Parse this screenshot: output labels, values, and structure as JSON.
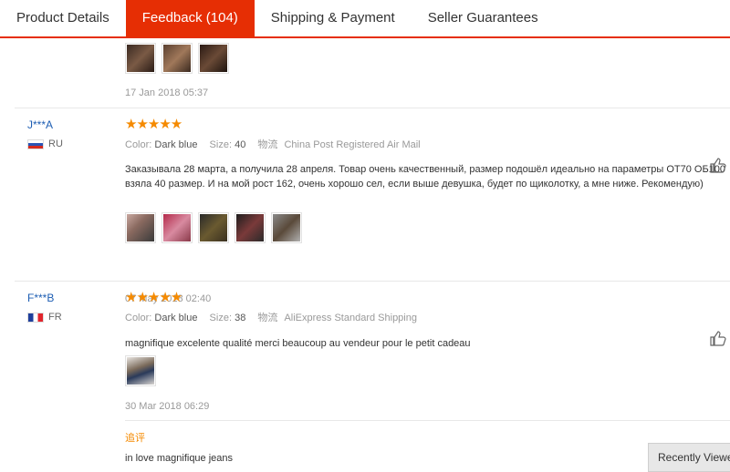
{
  "tabs": [
    {
      "label": "Product Details"
    },
    {
      "label": "Feedback (104)"
    },
    {
      "label": "Shipping & Payment"
    },
    {
      "label": "Seller Guarantees"
    }
  ],
  "top_partial": {
    "date": "17 Jan 2018 05:37"
  },
  "labels": {
    "color": "Color:",
    "size": "Size:",
    "logistics": "物流"
  },
  "reviews": [
    {
      "user": "J***A",
      "country": "RU",
      "color_value": "Dark blue",
      "size_value": "40",
      "shipping": "China Post Registered Air Mail",
      "text": "Заказывала 28 марта, а получила 28 апреля. Товар очень качественный, размер подошёл идеально на параметры ОТ70 ОБ100 взяла 40 размер. И на мой рост 162, очень хорошо сел, если выше девушка, будет по щиколотку, а мне ниже. Рекомендую)",
      "date": "07 May 2018 02:40"
    },
    {
      "user": "F***B",
      "country": "FR",
      "color_value": "Dark blue",
      "size_value": "38",
      "shipping": "AliExpress Standard Shipping",
      "text": "magnifique excelente qualité merci beaucoup au vendeur pour le petit cadeau",
      "date": "30 Mar 2018 06:29",
      "additional_label": "追评",
      "additional_text": "in love magnifique jeans"
    }
  ],
  "recently_viewed": "Recently Viewed",
  "stars": "★★★★★",
  "icons": {
    "like": "thumbs-up-icon",
    "star": "star-icon"
  },
  "colors": {
    "accent": "#e62e04",
    "star": "#f58a00",
    "user_link": "#1e5eb3"
  }
}
